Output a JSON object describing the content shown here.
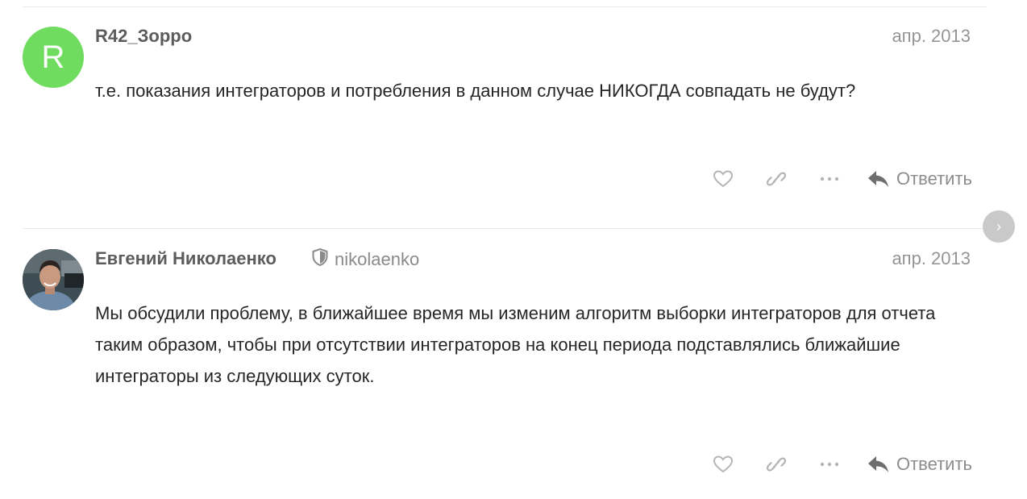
{
  "posts": [
    {
      "avatar_letter": "R",
      "avatar_color": "#6fdc5f",
      "username": "R42_Зорро",
      "handle": "",
      "date": "апр. 2013",
      "text": "т.е. показания интеграторов и потребления в данном случае НИКОГДА совпадать не будут?",
      "reply_label": "Ответить"
    },
    {
      "avatar_letter": "",
      "username": "Евгений Николаенко",
      "badge_icon": "shield-icon",
      "handle": "nikolaenko",
      "date": "апр. 2013",
      "text": "Мы обсудили проблему, в ближайшее время мы изменим алгоритм выборки интеграторов для отчета таким образом, чтобы при отсутствии интеграторов на конец периода подставлялись ближайшие интеграторы из следующих суток.",
      "reply_label": "Ответить"
    }
  ],
  "icons": {
    "like": "heart-icon",
    "share": "link-icon",
    "more": "more-icon",
    "reply": "reply-arrow-icon",
    "next": "chevron-right-icon"
  },
  "colors": {
    "avatar_green": "#6fdc5f",
    "muted_icon": "#b2b2b2",
    "scroll_button": "#c9c9c9"
  }
}
